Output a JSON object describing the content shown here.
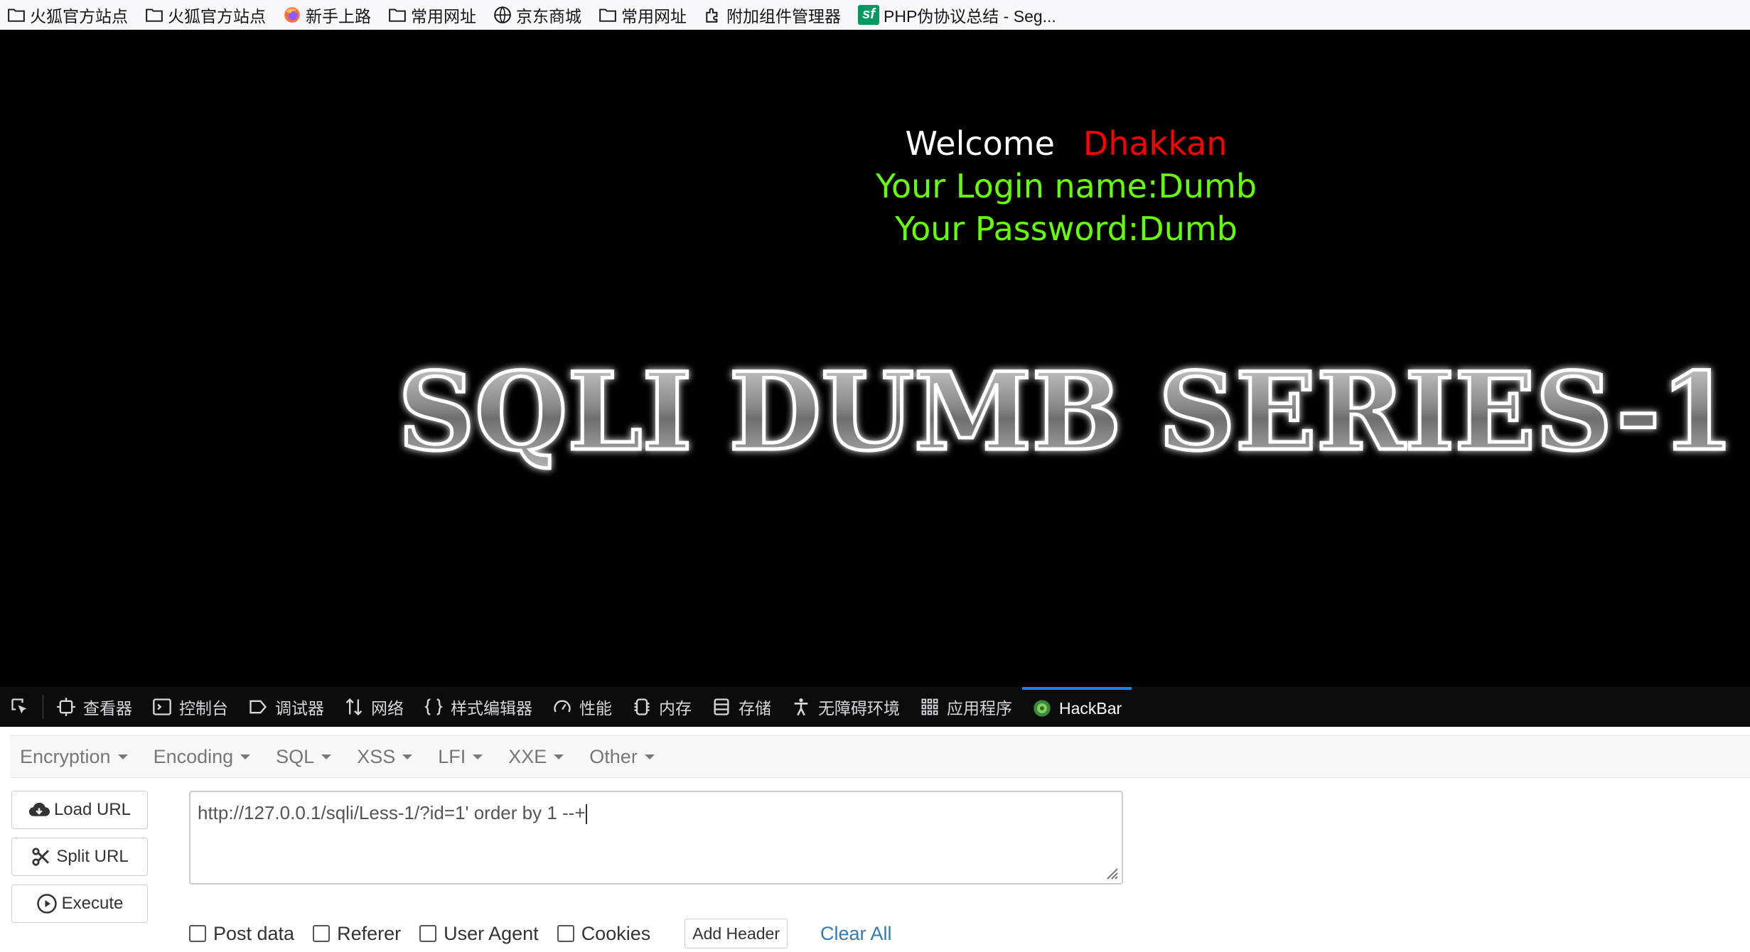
{
  "bookmarks": [
    {
      "label": "火狐官方站点",
      "icon": "folder-icon"
    },
    {
      "label": "火狐官方站点",
      "icon": "folder-icon"
    },
    {
      "label": "新手上路",
      "icon": "firefox-icon"
    },
    {
      "label": "常用网址",
      "icon": "folder-icon"
    },
    {
      "label": "京东商城",
      "icon": "globe-icon"
    },
    {
      "label": "常用网址",
      "icon": "folder-icon"
    },
    {
      "label": "附加组件管理器",
      "icon": "puzzle-icon"
    },
    {
      "label": "PHP伪协议总结 - Seg...",
      "icon": "sf-icon"
    }
  ],
  "page": {
    "welcome": "Welcome",
    "name": "Dhakkan",
    "login_line": "Your Login name:Dumb",
    "password_line": "Your Password:Dumb",
    "banner": "SQLI DUMB SERIES-1"
  },
  "devtools": {
    "tabs": [
      {
        "label": "查看器",
        "icon": "inspector-icon"
      },
      {
        "label": "控制台",
        "icon": "console-icon"
      },
      {
        "label": "调试器",
        "icon": "debugger-icon"
      },
      {
        "label": "网络",
        "icon": "network-icon"
      },
      {
        "label": "样式编辑器",
        "icon": "style-editor-icon"
      },
      {
        "label": "性能",
        "icon": "performance-icon"
      },
      {
        "label": "内存",
        "icon": "memory-icon"
      },
      {
        "label": "存储",
        "icon": "storage-icon"
      },
      {
        "label": "无障碍环境",
        "icon": "accessibility-icon"
      },
      {
        "label": "应用程序",
        "icon": "application-icon"
      },
      {
        "label": "HackBar",
        "icon": "hackbar-icon"
      }
    ],
    "active_tab": "HackBar"
  },
  "hackbar": {
    "menu": [
      "Encryption",
      "Encoding",
      "SQL",
      "XSS",
      "LFI",
      "XXE",
      "Other"
    ],
    "buttons": {
      "load": "Load URL",
      "split": "Split URL",
      "execute": "Execute"
    },
    "url": "http://127.0.0.1/sqli/Less-1/?id=1' order by 1 --+",
    "options": {
      "post_data": "Post data",
      "referer": "Referer",
      "user_agent": "User Agent",
      "cookies": "Cookies"
    },
    "add_header": "Add Header",
    "clear_all": "Clear All"
  },
  "colors": {
    "welcome": "#ffffff",
    "name": "#ff0000",
    "credentials": "#66ff00",
    "active_tab_accent": "#0a84ff",
    "link": "#337ab7"
  }
}
